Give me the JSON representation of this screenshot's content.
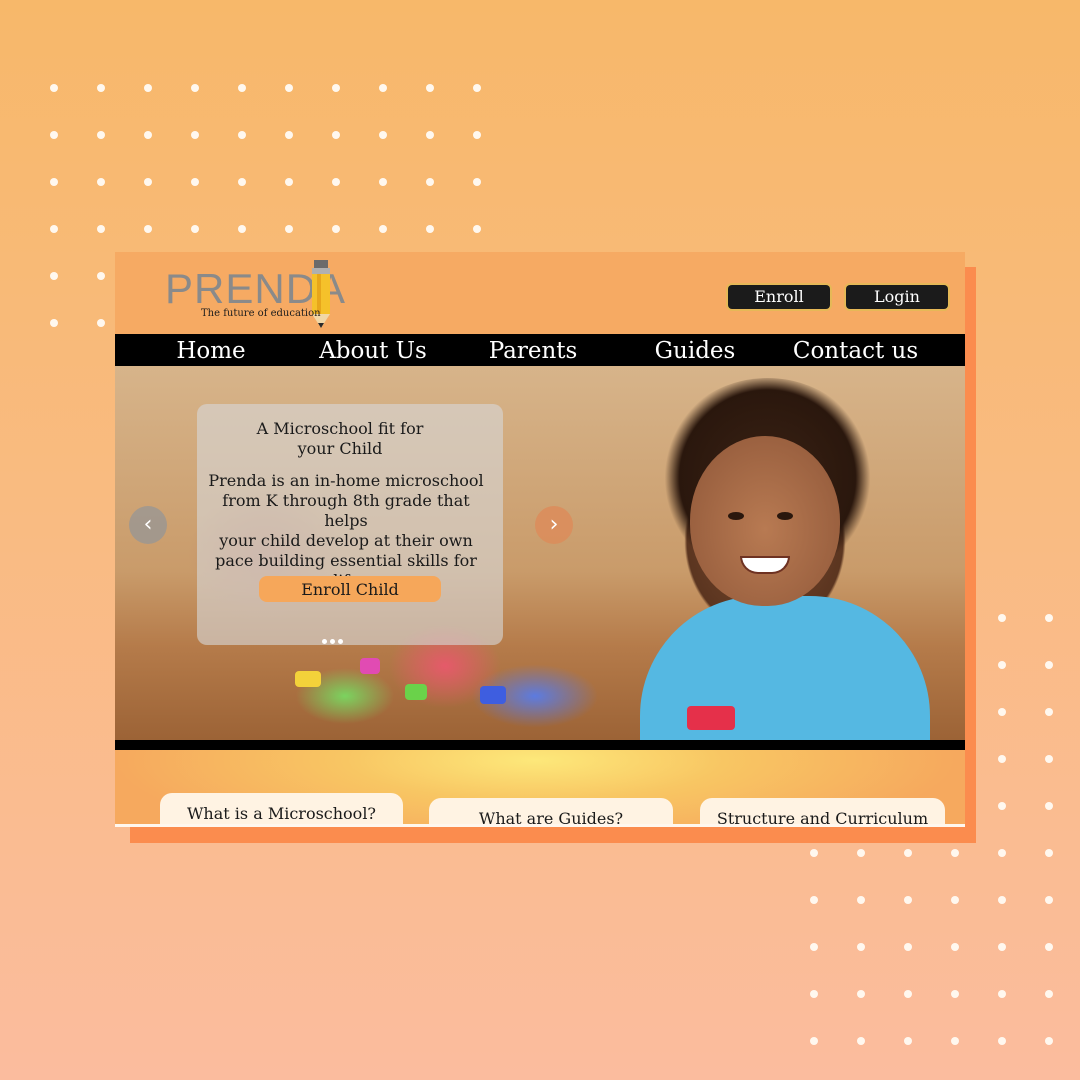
{
  "brand": {
    "name": "PRENDA",
    "tagline": "The future of education"
  },
  "header": {
    "enroll_label": "Enroll",
    "login_label": "Login"
  },
  "nav": {
    "items": [
      "Home",
      "About Us",
      "Parents",
      "Guides",
      "Contact us"
    ]
  },
  "hero": {
    "title_line1": "A Microschool fit for",
    "title_line2": "your Child",
    "body_line1": "Prenda is an in-home microschool",
    "body_line2": "from K through 8th grade that helps",
    "body_line3": "your child develop at their own",
    "body_line4": "pace building essential skills for life",
    "cta_label": "Enroll Child",
    "prev_icon": "chevron-left-icon",
    "next_icon": "chevron-right-icon",
    "slide_count": 3
  },
  "cards": [
    "What is a Microschool?",
    "What are Guides?",
    "Structure and Curriculum"
  ],
  "colors": {
    "background": "#f7b86a",
    "accent_orange": "#fb8c4e",
    "nav_bg": "#000000",
    "button_dark": "#1b1b1b",
    "cta": "#f6a75a"
  }
}
